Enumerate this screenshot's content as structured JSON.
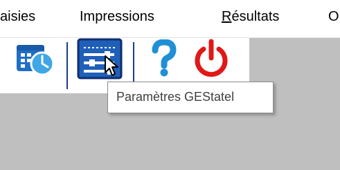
{
  "menubar": {
    "items": [
      {
        "label_pre": "",
        "label_ul": "",
        "label_post": "aisies"
      },
      {
        "label_pre": "",
        "label_ul": "",
        "label_post": "Impressions"
      },
      {
        "label_pre": "",
        "label_ul": "R",
        "label_post": "ésultats"
      },
      {
        "label_pre": "",
        "label_ul": "",
        "label_post": "O"
      }
    ]
  },
  "toolbar": {
    "buttons": [
      {
        "icon": "calendar-clock-icon"
      },
      {
        "icon": "settings-sliders-icon"
      },
      {
        "icon": "help-question-icon"
      },
      {
        "icon": "power-icon"
      }
    ]
  },
  "tooltip": {
    "text": "Paramètres GEStatel"
  },
  "colors": {
    "menubar_bg": "#ffffff",
    "workspace_bg": "#bfbfbf",
    "icon_blue": "#1f6fc4",
    "icon_cyan": "#3fa7e6",
    "power_red": "#e01818"
  }
}
